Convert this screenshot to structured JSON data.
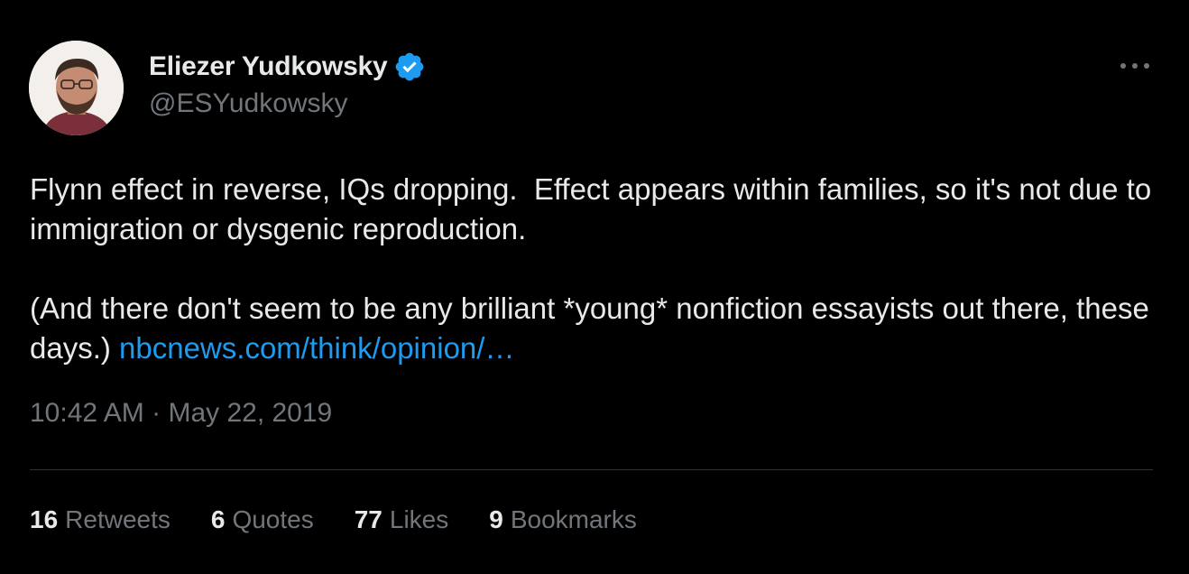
{
  "author": {
    "display_name": "Eliezer Yudkowsky",
    "handle": "@ESYudkowsky",
    "verified_icon": "verified-badge-icon",
    "verified_color": "#1d9bf0"
  },
  "tweet": {
    "paragraph_1": "Flynn effect in reverse, IQs dropping.  Effect appears within families, so it's not due to immigration or dysgenic reproduction.",
    "paragraph_2_text": "(And there don't seem to be any brilliant *young* nonfiction essayists out there, these days.) ",
    "paragraph_2_link": "nbcnews.com/think/opinion/…",
    "time": "10:42 AM",
    "separator": "·",
    "date": "May 22, 2019"
  },
  "stats": {
    "retweets_count": "16",
    "retweets_label": "Retweets",
    "quotes_count": "6",
    "quotes_label": "Quotes",
    "likes_count": "77",
    "likes_label": "Likes",
    "bookmarks_count": "9",
    "bookmarks_label": "Bookmarks"
  },
  "colors": {
    "background": "#000000",
    "text_primary": "#e7e9ea",
    "text_secondary": "#71767b",
    "link": "#1d9bf0",
    "divider": "#2f3336"
  }
}
